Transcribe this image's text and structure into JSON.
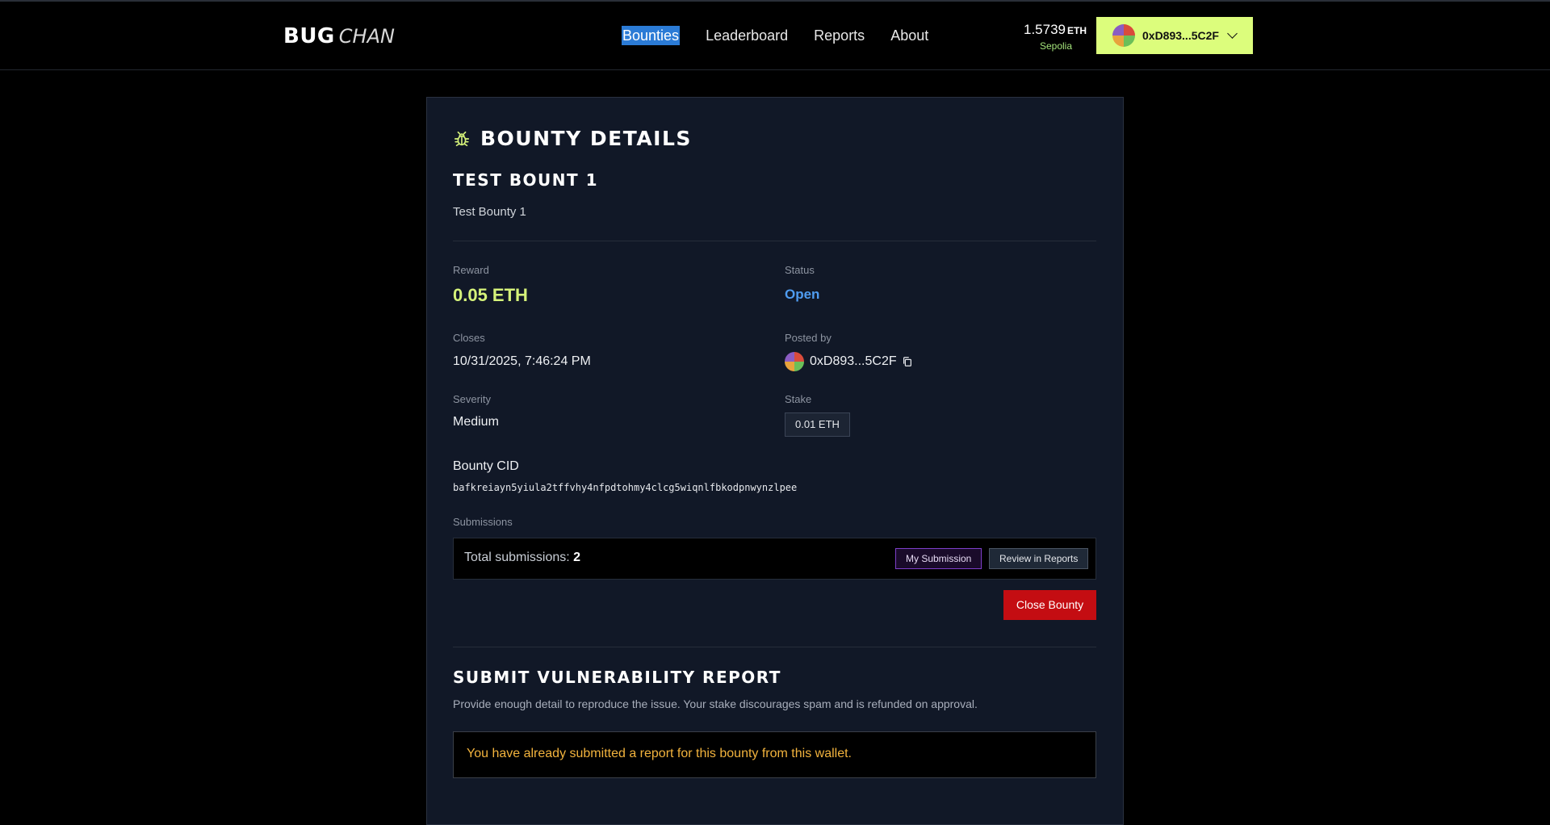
{
  "header": {
    "logo_bold": "BUG",
    "logo_italic": "CHAN",
    "nav": [
      "Bounties",
      "Leaderboard",
      "Reports",
      "About"
    ],
    "active_nav": "Bounties",
    "balance": "1.5739",
    "balance_unit": "ETH",
    "network": "Sepolia",
    "wallet_address": "0xD893...5C2F"
  },
  "page": {
    "heading": "BOUNTY DETAILS",
    "bounty_title": "TEST BOUNT 1",
    "bounty_description": "Test Bounty 1"
  },
  "details": {
    "reward_label": "Reward",
    "reward_value": "0.05 ETH",
    "status_label": "Status",
    "status_value": "Open",
    "closes_label": "Closes",
    "closes_value": "10/31/2025, 7:46:24 PM",
    "posted_label": "Posted by",
    "posted_value": "0xD893...5C2F",
    "severity_label": "Severity",
    "severity_value": "Medium",
    "stake_label": "Stake",
    "stake_value": "0.01 ETH",
    "cid_label": "Bounty CID",
    "cid_value": "bafkreiayn5yiula2tffvhy4nfpdtohmy4clcg5wiqnlfbkodpnwynzlpee"
  },
  "submissions": {
    "label": "Submissions",
    "total_label": "Total submissions:",
    "total_count": "2",
    "my_submission_button": "My Submission",
    "review_button": "Review in Reports",
    "close_bounty_button": "Close Bounty"
  },
  "submit": {
    "title": "SUBMIT VULNERABILITY REPORT",
    "description": "Provide enough detail to reproduce the issue. Your stake discourages spam and is refunded on approval.",
    "notice": "You have already submitted a report for this bounty from this wallet."
  },
  "colors": {
    "accent": "#dcfd7c",
    "reward": "#d5f27a",
    "status_open": "#4f9cf0",
    "danger": "#c40d12",
    "notice": "#f2b33d"
  }
}
